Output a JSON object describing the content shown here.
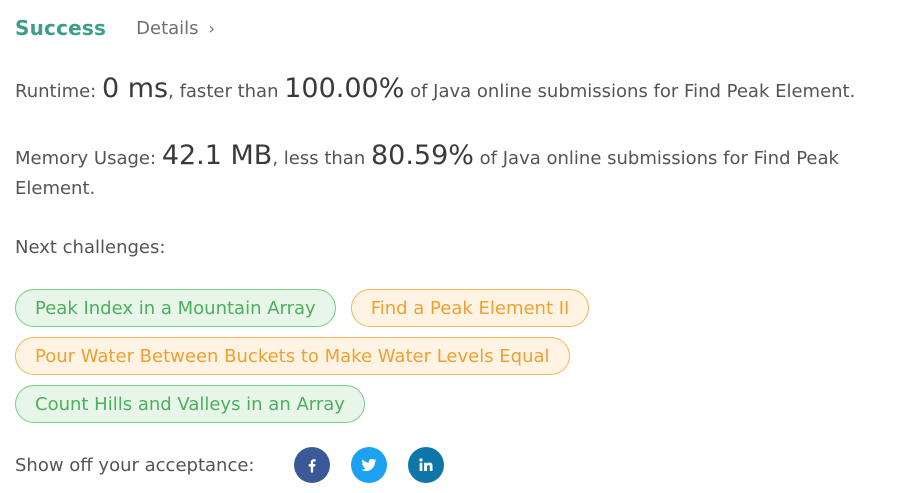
{
  "header": {
    "status": "Success",
    "details_label": "Details",
    "chevron": "›"
  },
  "runtime": {
    "label": "Runtime:",
    "value": "0 ms",
    "comparison": ", faster than",
    "percent": "100.00%",
    "suffix": "of Java online submissions for Find Peak Element."
  },
  "memory": {
    "label": "Memory Usage:",
    "value": "42.1 MB",
    "comparison": ", less than",
    "percent": "80.59%",
    "suffix": "of Java online submissions for Find Peak Element."
  },
  "next": {
    "label": "Next challenges:",
    "challenges": [
      {
        "title": "Peak Index in a Mountain Array",
        "difficulty": "easy"
      },
      {
        "title": "Find a Peak Element II",
        "difficulty": "medium"
      },
      {
        "title": "Pour Water Between Buckets to Make Water Levels Equal",
        "difficulty": "medium"
      },
      {
        "title": "Count Hills and Valleys in an Array",
        "difficulty": "easy"
      }
    ]
  },
  "share": {
    "label": "Show off your acceptance:",
    "networks": [
      {
        "icon": "facebook-icon",
        "color": "#3b5998"
      },
      {
        "icon": "twitter-icon",
        "color": "#1da1f2"
      },
      {
        "icon": "linkedin-icon",
        "color": "#0e76a8"
      }
    ]
  },
  "colors": {
    "success": "#3a9e8a",
    "easy_text": "#4caf5e",
    "easy_border": "#7ec98a",
    "medium_text": "#f0a032",
    "medium_border": "#f3b557"
  }
}
